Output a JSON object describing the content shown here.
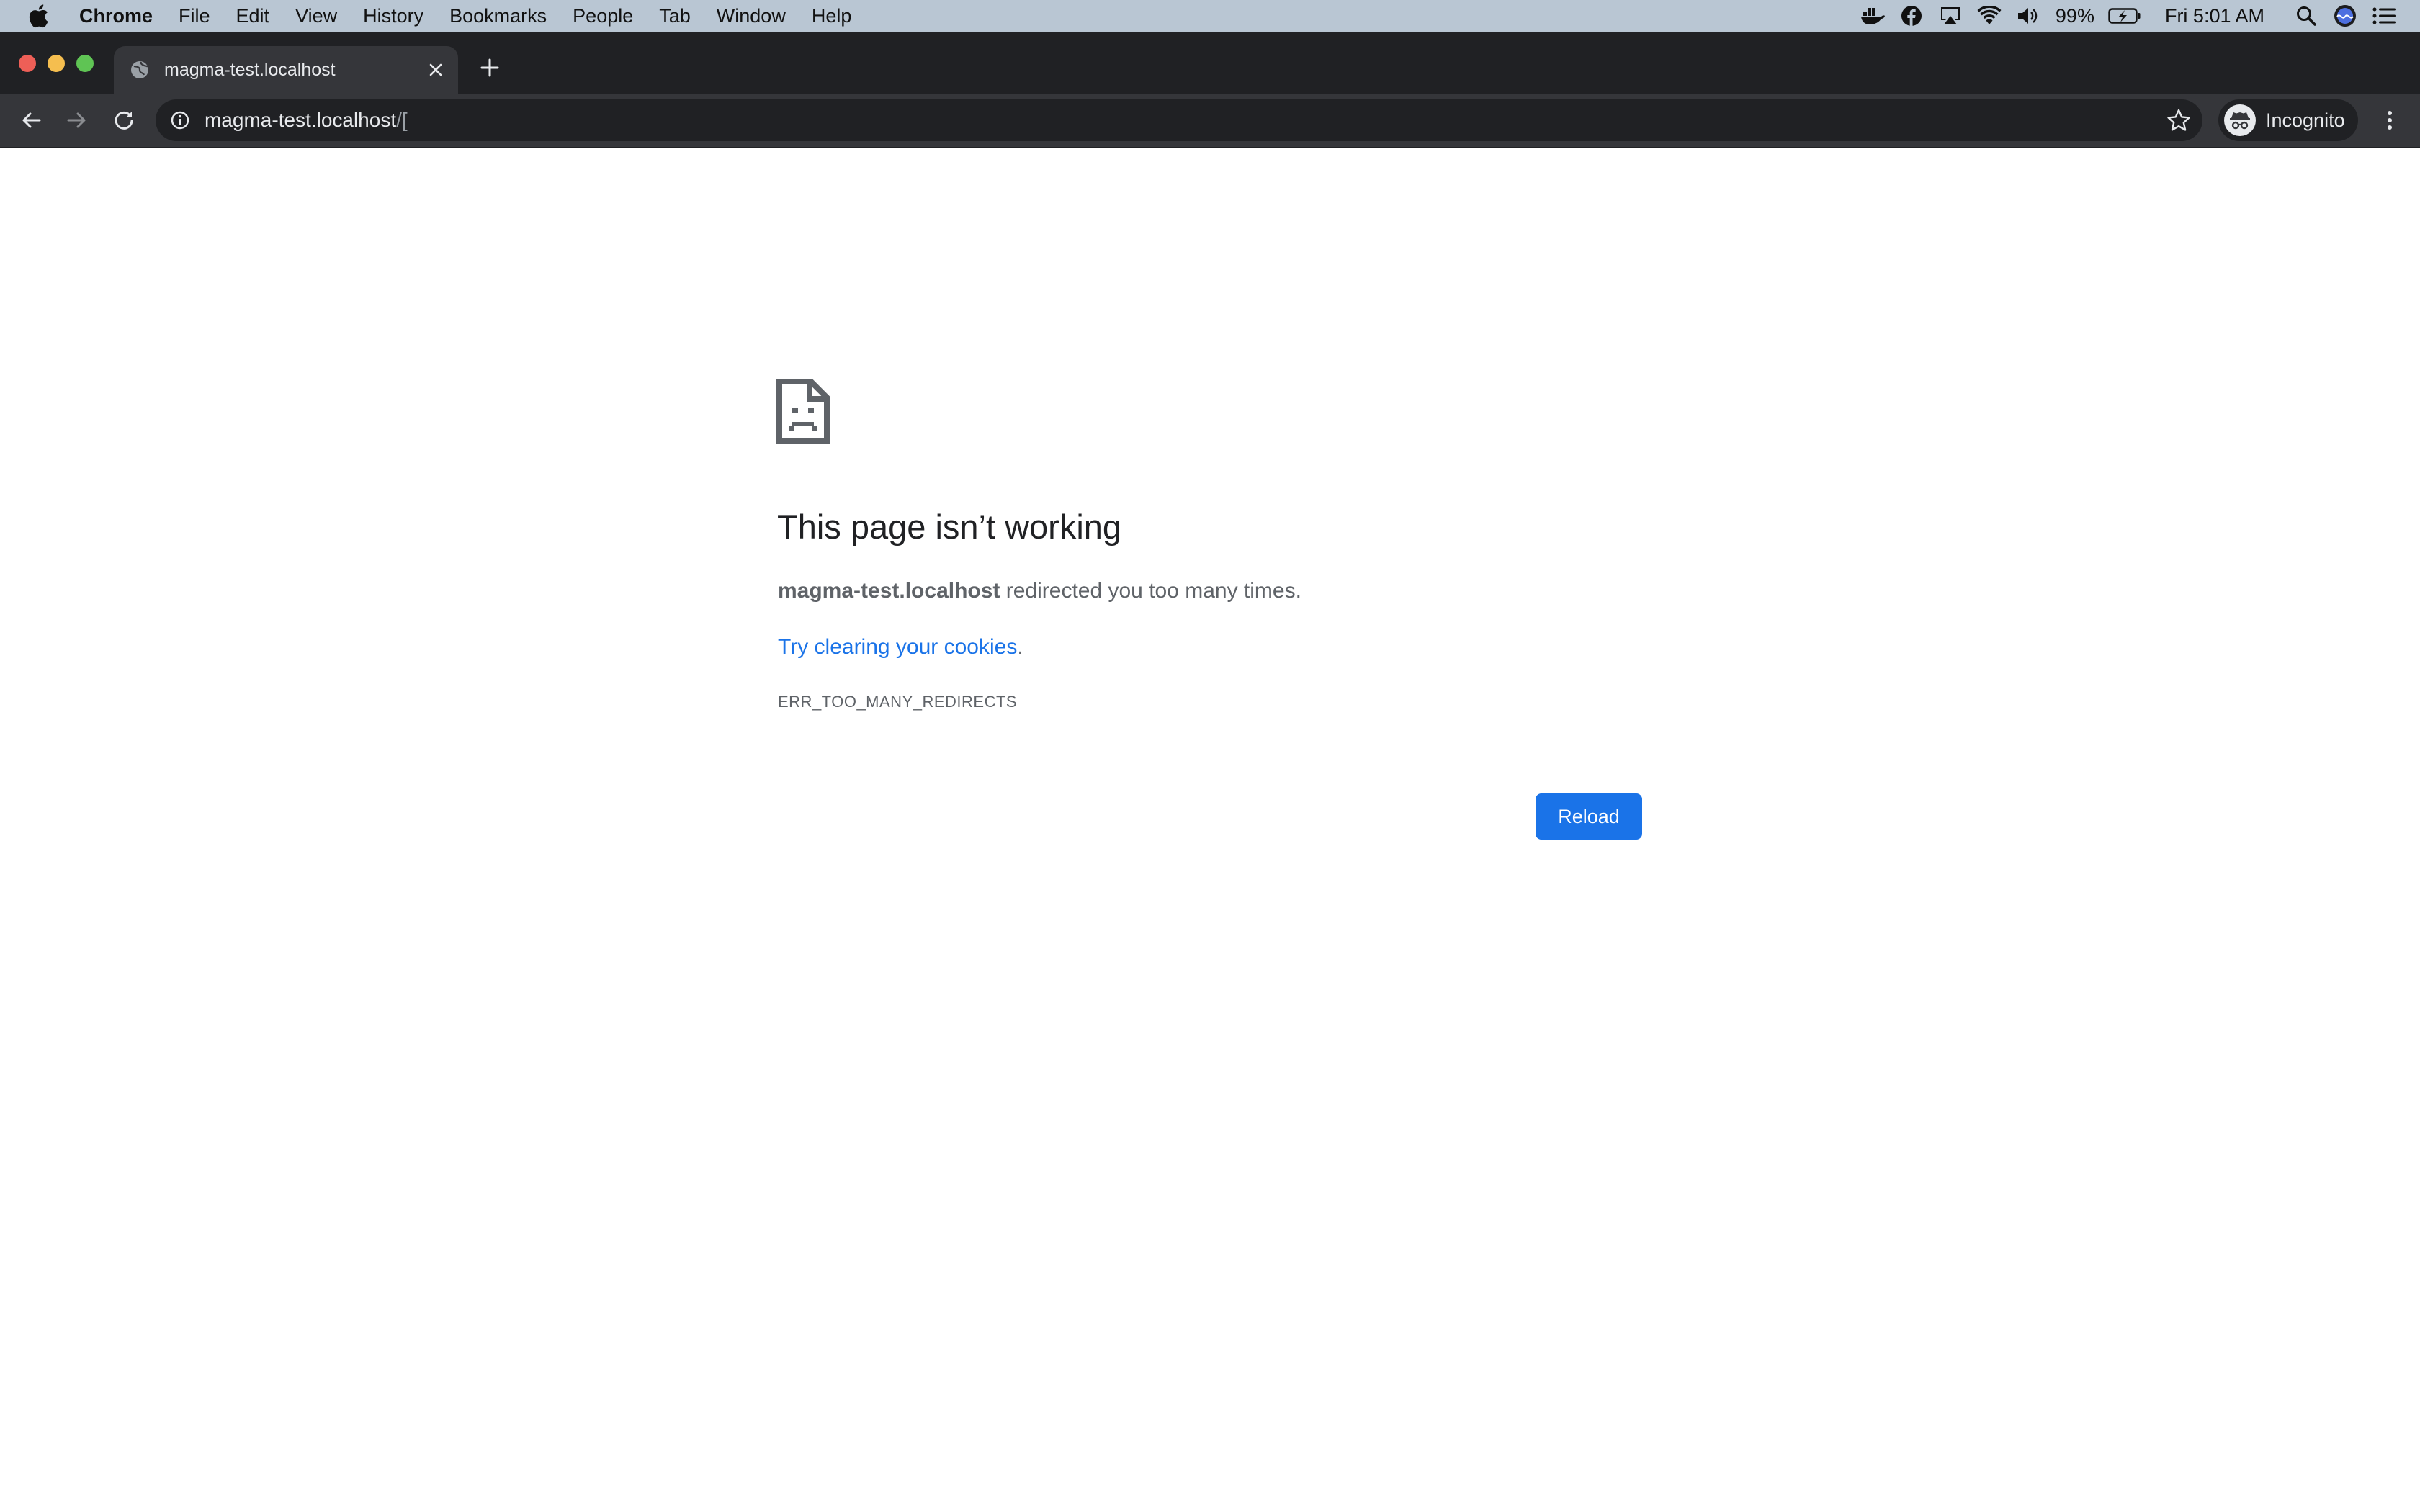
{
  "menubar": {
    "app_name": "Chrome",
    "items": [
      "File",
      "Edit",
      "View",
      "History",
      "Bookmarks",
      "People",
      "Tab",
      "Window",
      "Help"
    ],
    "battery": "99%",
    "clock": "Fri 5:01 AM",
    "status_icons": [
      "docker-icon",
      "facebook-icon",
      "airplay-icon",
      "wifi-icon",
      "volume-icon",
      "battery-charging-icon",
      "spotlight-search-icon",
      "siri-icon",
      "notification-center-icon"
    ]
  },
  "tab": {
    "title": "magma-test.localhost"
  },
  "omnibox": {
    "host": "magma-test.localhost",
    "path": "/["
  },
  "profile": {
    "label": "Incognito"
  },
  "error": {
    "heading": "This page isn’t working",
    "host": "magma-test.localhost",
    "message": " redirected you too many times.",
    "suggestion_link": "Try clearing your cookies",
    "suggestion_end": ".",
    "code": "ERR_TOO_MANY_REDIRECTS",
    "reload_label": "Reload"
  },
  "colors": {
    "menubar_bg": "#b9c6d3",
    "tabstrip_bg": "#202124",
    "toolbar_bg": "#35363a",
    "link": "#1a73e8",
    "reload_button": "#1a73e8"
  }
}
